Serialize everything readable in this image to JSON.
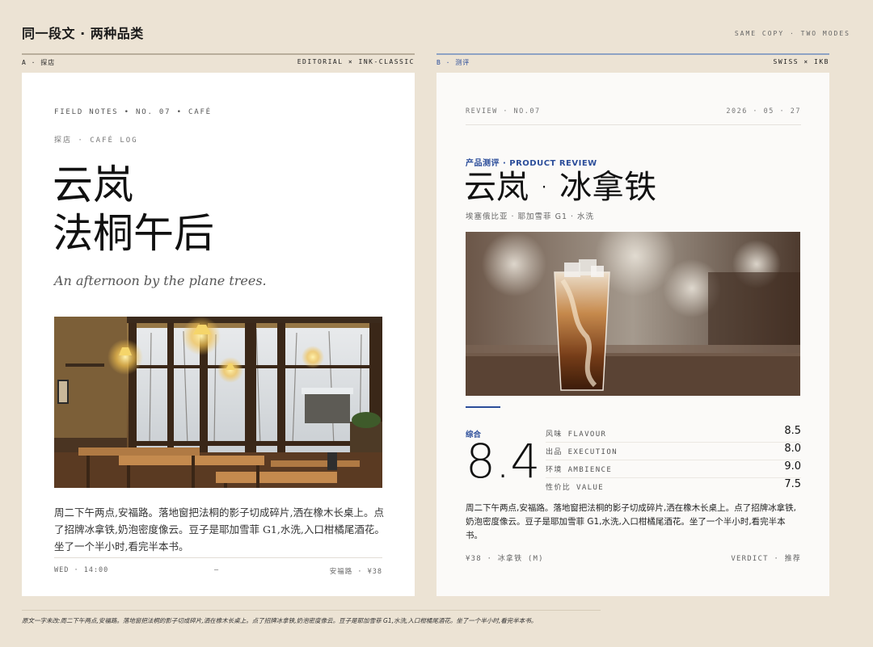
{
  "header": {
    "title": "同一段文 · 两种品类",
    "subtitle": "SAME COPY · TWO MODES"
  },
  "panel_a": {
    "label": "A · 探店",
    "style_label": "EDITORIAL × INK-CLASSIC",
    "kicker": "FIELD NOTES • NO. 07 • CAFÉ",
    "section": "探店 · CAFÉ LOG",
    "title_line1": "云岚",
    "title_line2": "法桐午后",
    "subtitle": "An afternoon by the plane trees.",
    "body": "周二下午两点,安福路。落地窗把法桐的影子切成碎片,洒在橡木长桌上。点了招牌冰拿铁,奶泡密度像云。豆子是耶加雪菲 G1,水洗,入口柑橘尾酒花。坐了一个半小时,看完半本书。",
    "footer_left": "WED · 14:00",
    "footer_mid": "—",
    "footer_right": "安福路 · ¥38"
  },
  "panel_b": {
    "label": "B · 测评",
    "style_label": "SWISS × IKB",
    "kicker": "REVIEW · NO.07",
    "date": "2026 · 05 · 27",
    "eyebrow": "产品测评 · PRODUCT REVIEW",
    "title": "云岚 · 冰拿铁",
    "meta": "埃塞俄比亚 · 耶加雪菲 G1 · 水洗",
    "overall_label": "综合",
    "overall_score": "8.4",
    "scores": [
      {
        "label": "风味 FLAVOUR",
        "value": "8.5"
      },
      {
        "label": "出品 EXECUTION",
        "value": "8.0"
      },
      {
        "label": "环境 AMBIENCE",
        "value": "9.0"
      },
      {
        "label": "性价比 VALUE",
        "value": "7.5"
      }
    ],
    "body": "周二下午两点,安福路。落地窗把法桐的影子切成碎片,洒在橡木长桌上。点了招牌冰拿铁,奶泡密度像云。豆子是耶加雪菲 G1,水洗,入口柑橘尾酒花。坐了一个半小时,看完半本书。",
    "footer_left": "¥38 · 冰拿铁 (M)",
    "footer_right": "VERDICT · 推荐"
  },
  "bottom_note": "原文一字未改:周二下午两点,安福路。落地窗把法桐的影子切成碎片,洒在橡木长桌上。点了招牌冰拿铁,奶泡密度像云。豆子是耶加雪菲 G1,水洗,入口柑橘尾酒花。坐了一个半小时,看完半本书。",
  "colors": {
    "background": "#ece3d4",
    "ikb_blue": "#2b4d9a",
    "card": "#ffffff"
  }
}
